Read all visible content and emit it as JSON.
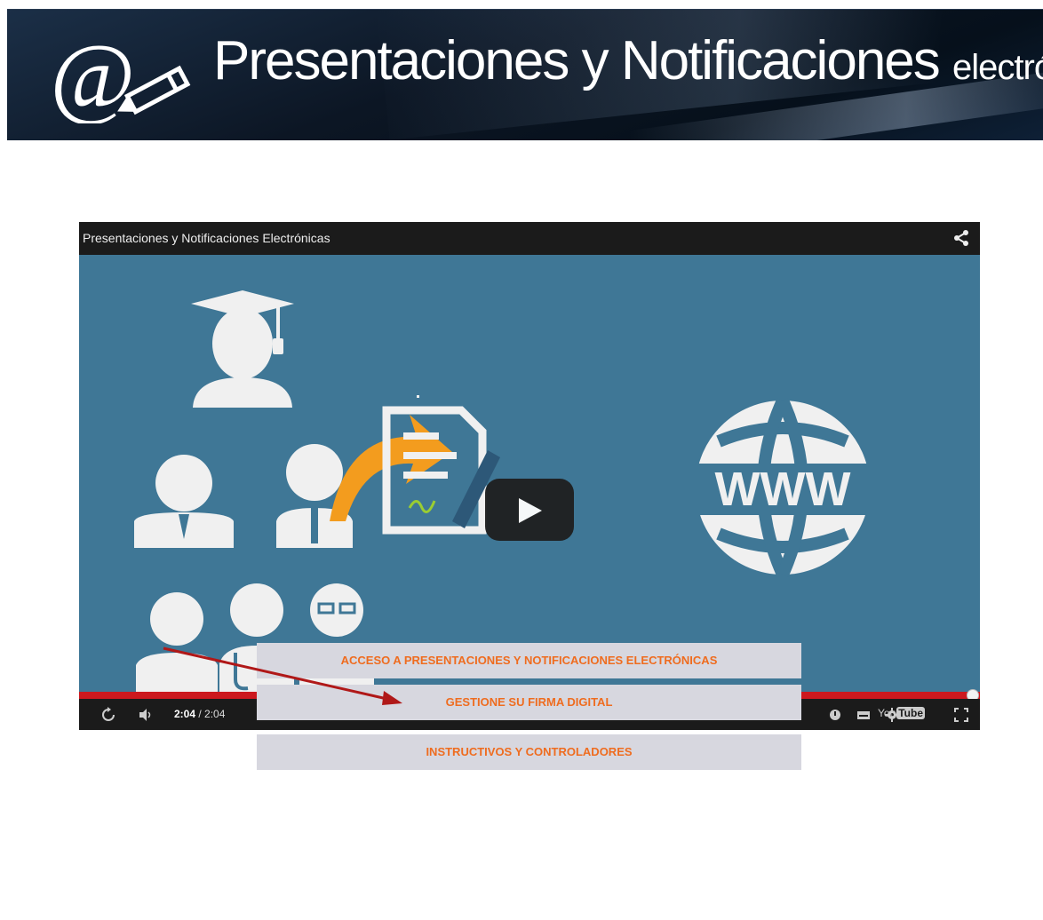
{
  "banner": {
    "title_main": "Presentaciones y Notificaciones",
    "title_small": "electrónicas",
    "logo_icon": "at-sign-pencil-icon"
  },
  "video": {
    "title": "Presentaciones y Notificaciones Electrónicas",
    "current_time": "2:04",
    "duration": "2:04",
    "progress": 1.0,
    "youtube_label_a": "You",
    "youtube_label_b": "Tube",
    "stage_color": "#3f7796",
    "progress_color": "#cc181e",
    "illustration_text": "</>",
    "globe_text": "WWW"
  },
  "menu": {
    "items": [
      {
        "label": "ACCESO A PRESENTACIONES Y NOTIFICACIONES ELECTRÓNICAS"
      },
      {
        "label": "GESTIONE SU FIRMA DIGITAL"
      },
      {
        "label": "INSTRUCTIVOS Y CONTROLADORES"
      }
    ],
    "text_color": "#ef6c1f",
    "background": "#d7d7df"
  },
  "annotation": {
    "arrow_color": "#b01818"
  }
}
